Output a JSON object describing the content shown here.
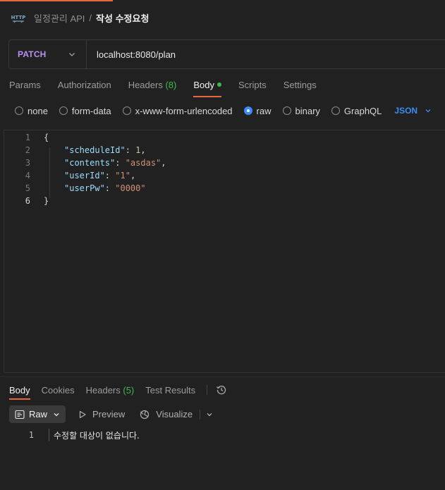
{
  "breadcrumb": {
    "icon": "http-icon",
    "parent": "일정관리 API",
    "separator": "/",
    "current": "작성 수정요청"
  },
  "request": {
    "method": "PATCH",
    "url": "localhost:8080/plan"
  },
  "request_tabs": [
    {
      "label": "Params"
    },
    {
      "label": "Authorization"
    },
    {
      "label": "Headers",
      "count": "(8)"
    },
    {
      "label": "Body",
      "active": true
    },
    {
      "label": "Scripts"
    },
    {
      "label": "Settings"
    }
  ],
  "body_types": {
    "options": [
      "none",
      "form-data",
      "x-www-form-urlencoded",
      "raw",
      "binary",
      "GraphQL"
    ],
    "selected": "raw",
    "format": "JSON"
  },
  "editor": {
    "line_numbers": [
      "1",
      "2",
      "3",
      "4",
      "5",
      "6"
    ],
    "open_brace": "{",
    "close_brace": "}",
    "fields": [
      {
        "key": "\"scheduleId\"",
        "value": "1",
        "type": "number",
        "trail": ","
      },
      {
        "key": "\"contents\"",
        "value": "\"asdas\"",
        "type": "string",
        "trail": ","
      },
      {
        "key": "\"userId\"",
        "value": "\"1\"",
        "type": "string",
        "trail": ","
      },
      {
        "key": "\"userPw\"",
        "value": "\"0000\"",
        "type": "string",
        "trail": ""
      }
    ]
  },
  "response": {
    "tabs": [
      {
        "label": "Body",
        "active": true
      },
      {
        "label": "Cookies"
      },
      {
        "label": "Headers",
        "count": "(5)"
      },
      {
        "label": "Test Results"
      }
    ],
    "view_mode": "Raw",
    "preview_label": "Preview",
    "visualize_label": "Visualize",
    "line_number": "1",
    "body_text": "수정할 대상이 없습니다."
  },
  "colors": {
    "accent": "#e8663d",
    "method": "#b792f2",
    "success": "#3fb950",
    "link": "#3b8cf6"
  }
}
